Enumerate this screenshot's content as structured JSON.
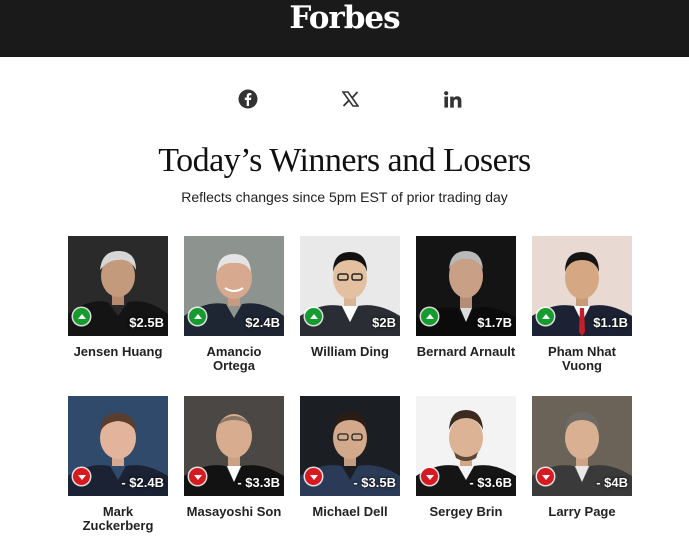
{
  "header": {
    "logo_text": "Forbes",
    "background_color": "#1a1a1a"
  },
  "share": {
    "icons": [
      "facebook-icon",
      "x-icon",
      "linkedin-icon"
    ]
  },
  "title": "Today’s Winners and Losers",
  "subtitle": "Reflects changes since 5pm EST of prior trading day",
  "colors": {
    "gain": "#169b2e",
    "loss": "#d71920"
  },
  "winners": [
    {
      "name": "Jensen Huang",
      "amount": "$2.5B",
      "direction": "up"
    },
    {
      "name": "Amancio Ortega",
      "amount": "$2.4B",
      "direction": "up"
    },
    {
      "name": "William Ding",
      "amount": "$2B",
      "direction": "up"
    },
    {
      "name": "Bernard Arnault",
      "amount": "$1.7B",
      "direction": "up"
    },
    {
      "name": "Pham Nhat Vuong",
      "amount": "$1.1B",
      "direction": "up"
    }
  ],
  "losers": [
    {
      "name": "Mark Zuckerberg",
      "amount": "- $2.4B",
      "direction": "down"
    },
    {
      "name": "Masayoshi Son",
      "amount": "- $3.3B",
      "direction": "down"
    },
    {
      "name": "Michael Dell",
      "amount": "- $3.5B",
      "direction": "down"
    },
    {
      "name": "Sergey Brin",
      "amount": "- $3.6B",
      "direction": "down"
    },
    {
      "name": "Larry Page",
      "amount": "- $4B",
      "direction": "down"
    }
  ]
}
